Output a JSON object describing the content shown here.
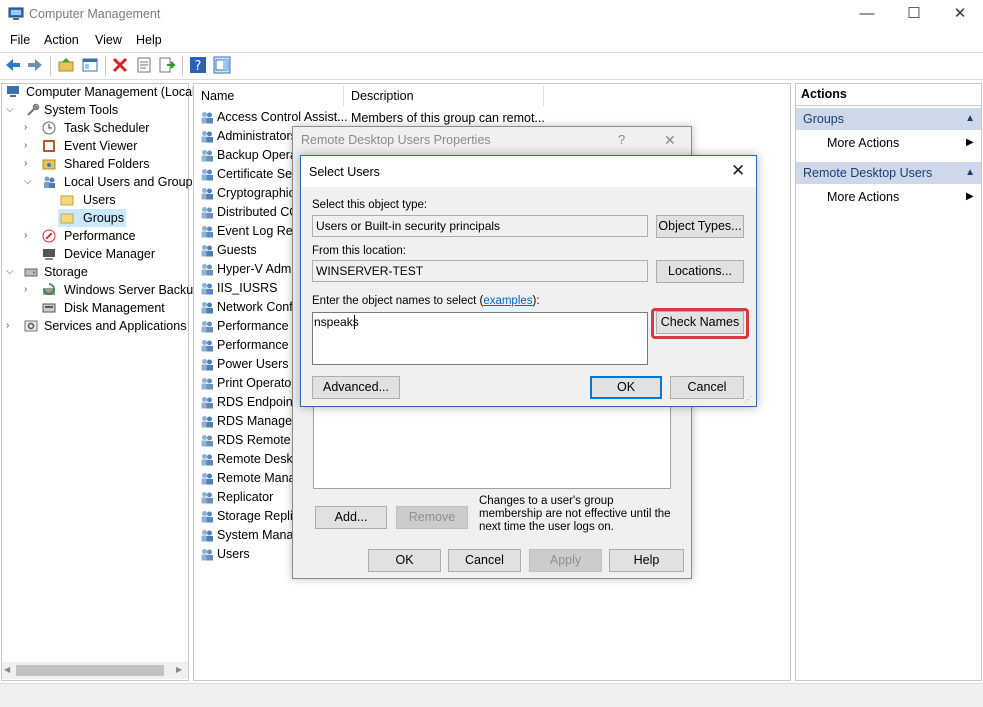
{
  "window": {
    "title": "Computer Management",
    "minimize": "—",
    "maximize": "☐",
    "close": "✕"
  },
  "menu": [
    "File",
    "Action",
    "View",
    "Help"
  ],
  "tree": {
    "root": "Computer Management (Local",
    "system_tools": "System Tools",
    "task_scheduler": "Task Scheduler",
    "event_viewer": "Event Viewer",
    "shared_folders": "Shared Folders",
    "local_users_groups": "Local Users and Groups",
    "users": "Users",
    "groups": "Groups",
    "performance": "Performance",
    "device_manager": "Device Manager",
    "storage": "Storage",
    "windows_server_backup": "Windows Server Backup",
    "disk_management": "Disk Management",
    "services_apps": "Services and Applications"
  },
  "list": {
    "col_name": "Name",
    "col_description": "Description",
    "first_description": "Members of this group can remot...",
    "groups": [
      "Access Control Assist...",
      "Administrators",
      "Backup Operat",
      "Certificate Serv",
      "Cryptographic",
      "Distributed CO",
      "Event Log Read",
      "Guests",
      "Hyper-V Admi",
      "IIS_IUSRS",
      "Network Confi",
      "Performance L",
      "Performance M",
      "Power Users",
      "Print Operator",
      "RDS Endpoint",
      "RDS Managem",
      "RDS Remote A",
      "Remote Deskto",
      "Remote Manag",
      "Replicator",
      "Storage Replic",
      "System Manag",
      "Users"
    ]
  },
  "actions": {
    "header": "Actions",
    "section1": "Groups",
    "section1_item": "More Actions",
    "section2": "Remote Desktop Users",
    "section2_item": "More Actions"
  },
  "props_dialog": {
    "title": "Remote Desktop Users Properties",
    "help_glyph": "?",
    "close_glyph": "✕",
    "add": "Add...",
    "remove": "Remove",
    "note": "Changes to a user's group membership are not effective until the next time the user logs on.",
    "ok": "OK",
    "cancel": "Cancel",
    "apply": "Apply",
    "help": "Help"
  },
  "select_dialog": {
    "title": "Select Users",
    "close_glyph": "✕",
    "object_type_label": "Select this object type:",
    "object_type_value": "Users or Built-in security principals",
    "object_types_button": "Object Types...",
    "location_label": "From this location:",
    "location_value": "WINSERVER-TEST",
    "locations_button": "Locations...",
    "names_label_prefix": "Enter the object names to select (",
    "names_label_link": "examples",
    "names_label_suffix": "):",
    "names_value": "nspeaks",
    "check_names_button": "Check Names",
    "advanced_button": "Advanced...",
    "ok": "OK",
    "cancel": "Cancel"
  },
  "colors": {
    "highlight": "#d9383f",
    "accent": "#0078d7",
    "actions_header_bg": "#cdd9ea",
    "selected_tree_bg": "#cce8ff"
  }
}
